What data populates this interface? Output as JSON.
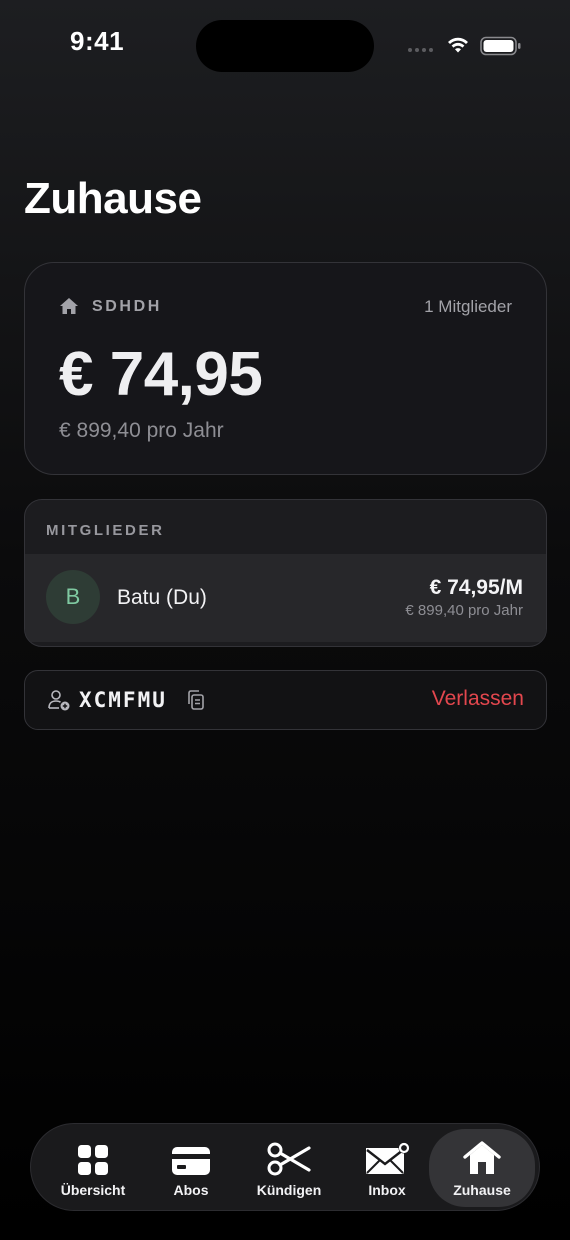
{
  "status_bar": {
    "time": "9:41"
  },
  "page": {
    "title": "Zuhause"
  },
  "home_card": {
    "name": "SDHDH",
    "members_count": "1 Mitglieder",
    "monthly_amount": "€ 74,95",
    "yearly_amount": "€ 899,40 pro Jahr"
  },
  "members": {
    "header": "MITGLIEDER",
    "items": [
      {
        "initial": "B",
        "name": "Batu (Du)",
        "price": "€ 74,95/M",
        "yearly": "€ 899,40 pro Jahr"
      }
    ]
  },
  "invite": {
    "code": "XCMFMU",
    "leave_label": "Verlassen"
  },
  "tab_bar": {
    "tabs": [
      {
        "label": "Übersicht",
        "icon": "grid-icon"
      },
      {
        "label": "Abos",
        "icon": "credit-card-icon"
      },
      {
        "label": "Kündigen",
        "icon": "scissors-icon"
      },
      {
        "label": "Inbox",
        "icon": "mail-icon"
      },
      {
        "label": "Zuhause",
        "icon": "house-icon",
        "active": true
      }
    ]
  },
  "colors": {
    "accent_red": "#e3474e",
    "avatar_green": "#7fc9a1",
    "card_bg": "#16161a"
  }
}
